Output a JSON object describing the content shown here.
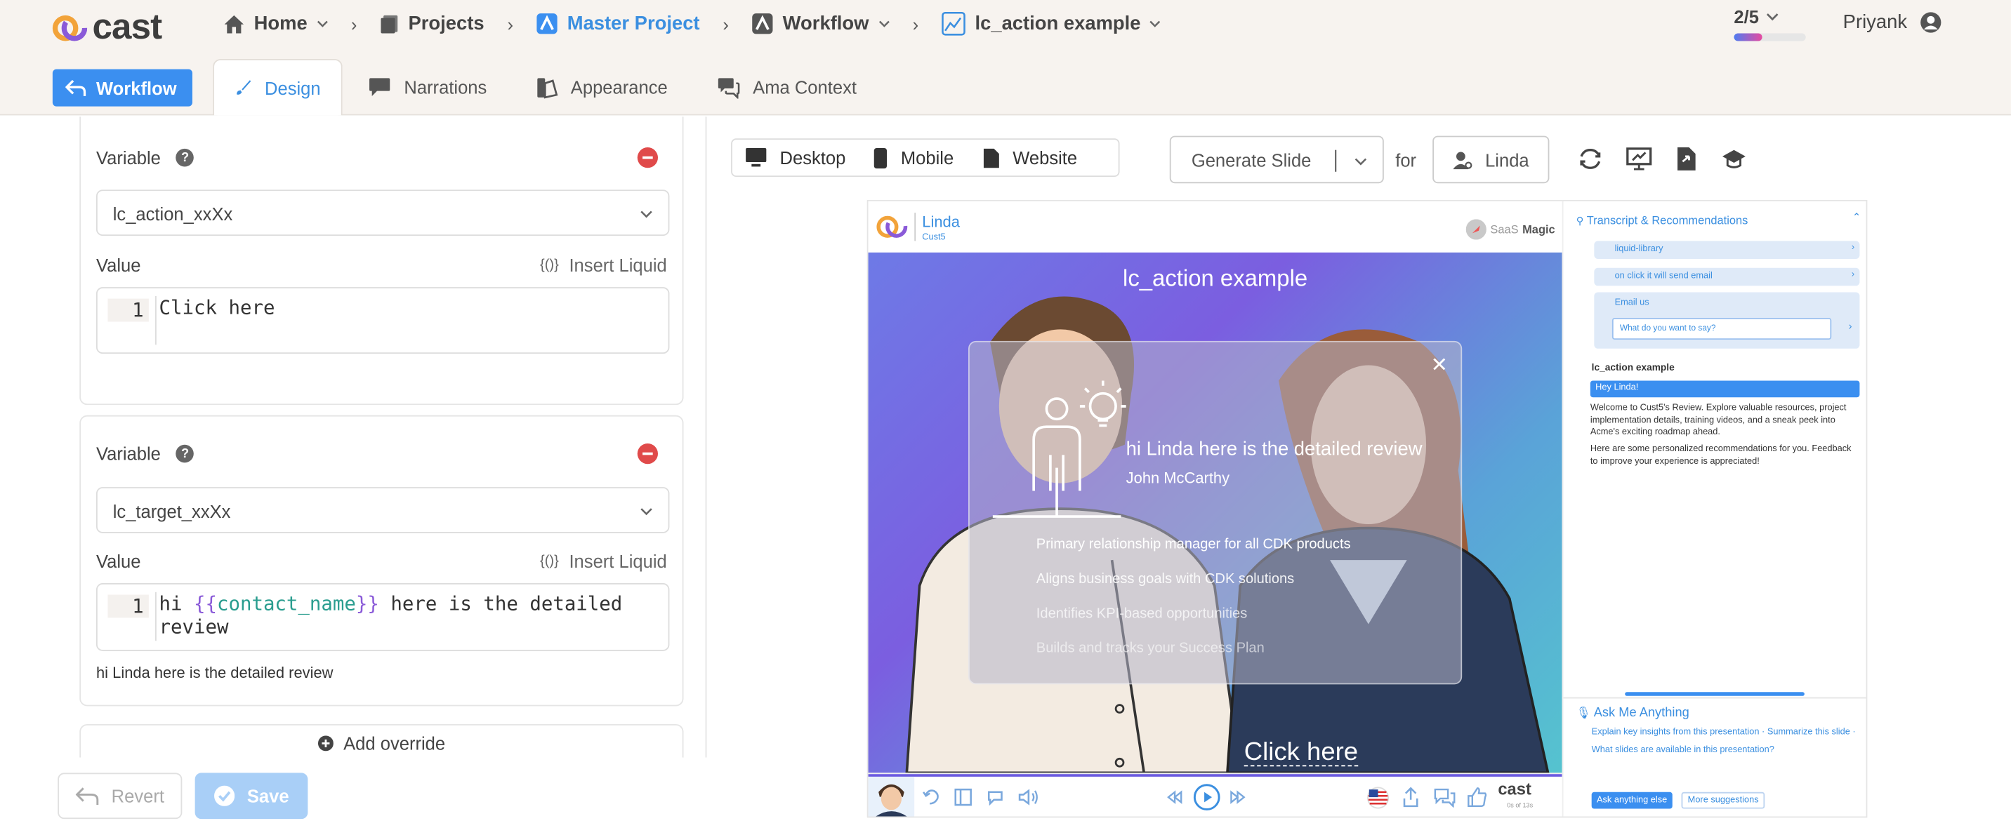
{
  "app": {
    "logo_text": "cast"
  },
  "breadcrumb": [
    {
      "label": "Home"
    },
    {
      "label": "Projects"
    },
    {
      "label": "Master Project"
    },
    {
      "label": "Workflow"
    },
    {
      "label": "lc_action example"
    }
  ],
  "pager": {
    "label": "2/5",
    "progress": 0.4
  },
  "user": {
    "name": "Priyank"
  },
  "tabs": {
    "back_button": "Workflow",
    "items": [
      "Design",
      "Narrations",
      "Appearance",
      "Ama Context"
    ]
  },
  "overrides": [
    {
      "variable_label": "Variable",
      "variable": "lc_action_xxXx",
      "value_label": "Value",
      "insert_liquid": "Insert Liquid",
      "line_number": "1",
      "code": "Click here"
    },
    {
      "variable_label": "Variable",
      "variable": "lc_target_xxXx",
      "value_label": "Value",
      "insert_liquid": "Insert Liquid",
      "line_number": "1",
      "code_prefix": "hi ",
      "code_open": "{{",
      "code_var": "contact_name",
      "code_close": "}}",
      "code_suffix": " here is the detailed review",
      "preview": "hi Linda here is the detailed review"
    }
  ],
  "add_override": "Add override",
  "actions": {
    "revert": "Revert",
    "save": "Save"
  },
  "device_tabs": [
    "Desktop",
    "Mobile",
    "Website"
  ],
  "generate": {
    "label": "Generate Slide",
    "for": "for",
    "persona": "Linda"
  },
  "slide": {
    "header_name": "Linda",
    "header_sub": "Cust5",
    "brand_prefix": "SaaS",
    "brand_bold": "Magic",
    "title": "lc_action example",
    "card_heading": "hi Linda here is the detailed review",
    "card_name": "John McCarthy",
    "bullets": [
      "Primary relationship manager for all CDK products",
      "Aligns business goals with CDK solutions",
      "Identifies KPI-based opportunities",
      "Builds and tracks your Success Plan"
    ],
    "cta": "Click here",
    "player_brand": "cast",
    "player_time": "0s of 13s"
  },
  "side": {
    "title": "Transcript & Recommendations",
    "pills": [
      "liquid-library",
      "on click it will send email"
    ],
    "email_title": "Email us",
    "email_placeholder": "What do you want to say?",
    "transcript_title": "lc_action example",
    "greeting": "Hey Linda!",
    "para1": "Welcome to Cust5's Review. Explore valuable resources, project implementation details, training videos, and a sneak peek into Acme's exciting roadmap ahead.",
    "para2": "Here are some personalized recommendations for you. Feedback to improve your experience is appreciated!",
    "ama_title": "Ask Me Anything",
    "suggestions": [
      "Explain key insights from this presentation",
      "Summarize this slide",
      "What slides are available in this presentation?"
    ],
    "ask_button": "Ask anything else",
    "more_button": "More suggestions"
  },
  "colors": {
    "accent": "#3b8ff0",
    "danger": "#e04a4a",
    "save_disabled": "#a9cff7"
  }
}
